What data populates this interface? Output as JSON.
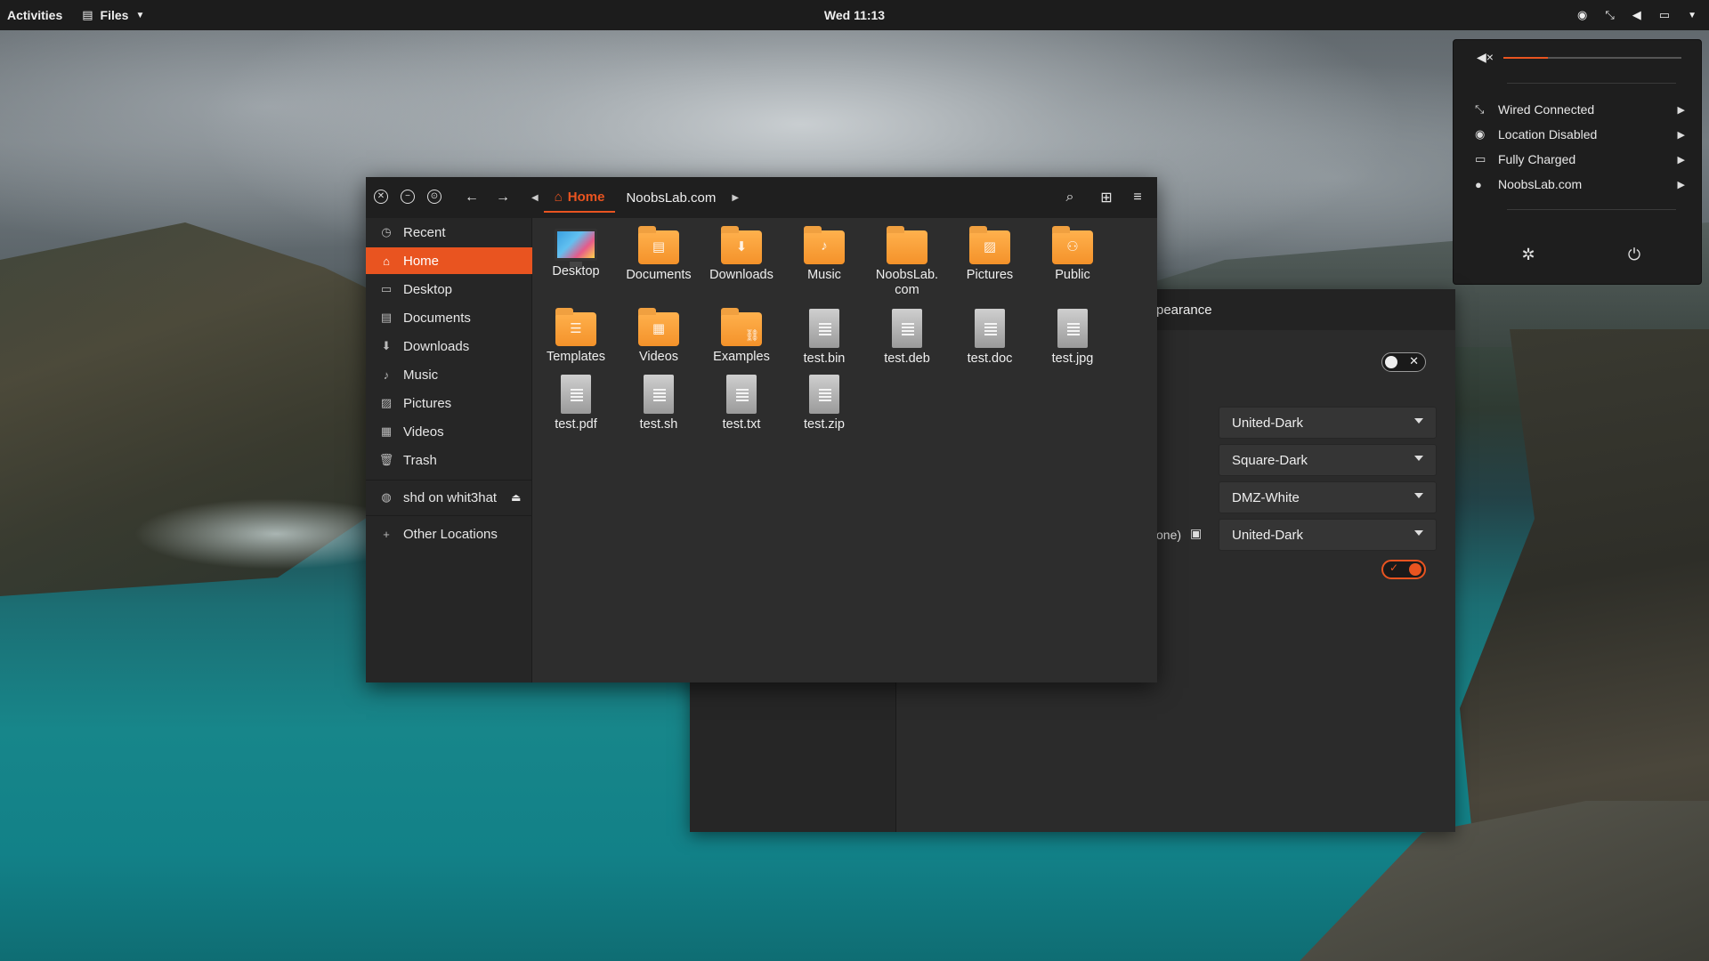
{
  "topbar": {
    "activities": "Activities",
    "app_name": "Files",
    "clock": "Wed 11:13"
  },
  "system_menu": {
    "volume_fraction": 0.25,
    "items": [
      {
        "icon": "network-wired-icon",
        "label": "Wired Connected"
      },
      {
        "icon": "location-icon",
        "label": "Location Disabled"
      },
      {
        "icon": "battery-icon",
        "label": "Fully Charged"
      },
      {
        "icon": "user-icon",
        "label": "NoobsLab.com"
      }
    ]
  },
  "tweaks": {
    "title_fragment": "pearance",
    "row_label_fragment": "one)",
    "combos": [
      "United-Dark",
      "Square-Dark",
      "DMZ-White",
      "United-Dark"
    ]
  },
  "files": {
    "path": [
      "Home",
      "NoobsLab.com"
    ],
    "sidebar": [
      {
        "icon": "clock-icon",
        "label": "Recent"
      },
      {
        "icon": "home-icon",
        "label": "Home",
        "active": true
      },
      {
        "icon": "desktop-icon",
        "label": "Desktop"
      },
      {
        "icon": "documents-icon",
        "label": "Documents"
      },
      {
        "icon": "downloads-icon",
        "label": "Downloads"
      },
      {
        "icon": "music-icon",
        "label": "Music"
      },
      {
        "icon": "pictures-icon",
        "label": "Pictures"
      },
      {
        "icon": "videos-icon",
        "label": "Videos"
      },
      {
        "icon": "trash-icon",
        "label": "Trash"
      }
    ],
    "network_mount": "shd on whit3hat",
    "other_locations": "Other Locations",
    "items": [
      {
        "name": "Desktop",
        "kind": "desktop"
      },
      {
        "name": "Documents",
        "kind": "folder"
      },
      {
        "name": "Downloads",
        "kind": "folder"
      },
      {
        "name": "Music",
        "kind": "folder"
      },
      {
        "name": "NoobsLab.\ncom",
        "kind": "folder"
      },
      {
        "name": "Pictures",
        "kind": "folder"
      },
      {
        "name": "Public",
        "kind": "folder"
      },
      {
        "name": "Templates",
        "kind": "folder"
      },
      {
        "name": "Videos",
        "kind": "folder"
      },
      {
        "name": "Examples",
        "kind": "folder"
      },
      {
        "name": "test.bin",
        "kind": "file"
      },
      {
        "name": "test.deb",
        "kind": "file"
      },
      {
        "name": "test.doc",
        "kind": "file"
      },
      {
        "name": "test.jpg",
        "kind": "file"
      },
      {
        "name": "test.pdf",
        "kind": "file"
      },
      {
        "name": "test.sh",
        "kind": "file"
      },
      {
        "name": "test.txt",
        "kind": "file"
      },
      {
        "name": "test.zip",
        "kind": "file"
      }
    ]
  },
  "colors": {
    "accent": "#e95420",
    "window_bg": "#2d2d2d",
    "topbar_bg": "#1c1c1c"
  }
}
